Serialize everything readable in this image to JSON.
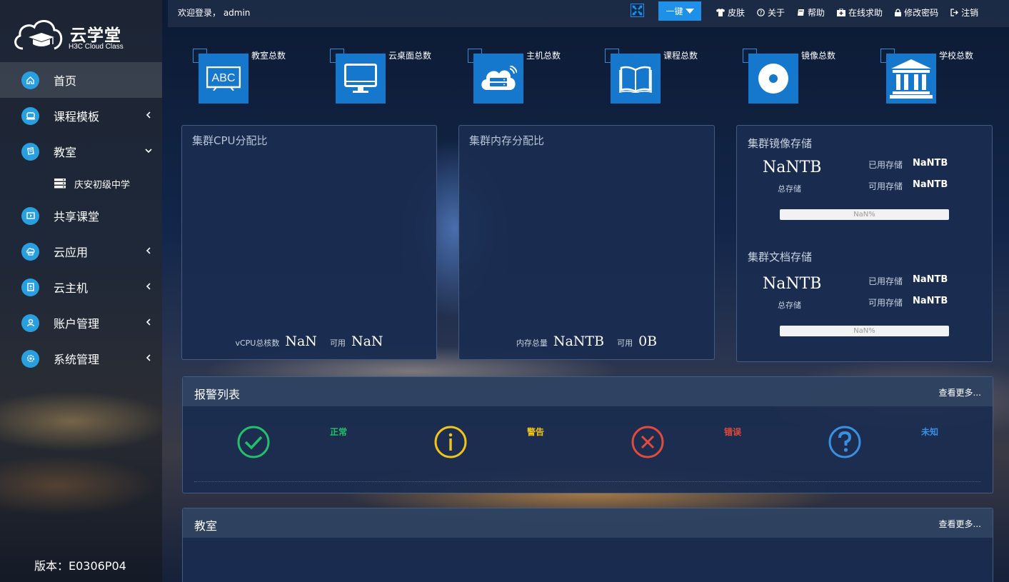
{
  "app": {
    "name": "云学堂",
    "brand": "H3C Cloud Class",
    "version_label": "版本：E0306P04"
  },
  "topbar": {
    "welcome": "欢迎登录， admin",
    "one_key": "一键",
    "links": [
      "皮肤",
      "关于",
      "帮助",
      "在线求助",
      "修改密码",
      "注销"
    ]
  },
  "sidebar": {
    "items": [
      {
        "label": "首页",
        "icon": "home-icon"
      },
      {
        "label": "课程模板",
        "icon": "template-icon"
      },
      {
        "label": "教室",
        "icon": "classroom-icon"
      },
      {
        "label": "庆安初级中学",
        "icon": "server-icon"
      },
      {
        "label": "共享课堂",
        "icon": "share-class-icon"
      },
      {
        "label": "云应用",
        "icon": "cloud-app-icon"
      },
      {
        "label": "云主机",
        "icon": "cloud-host-icon"
      },
      {
        "label": "账户管理",
        "icon": "account-icon"
      },
      {
        "label": "系统管理",
        "icon": "settings-icon"
      }
    ]
  },
  "tiles": [
    {
      "label": "教室总数",
      "icon": "abc-board-icon"
    },
    {
      "label": "云桌面总数",
      "icon": "monitor-icon"
    },
    {
      "label": "主机总数",
      "icon": "cloud-server-icon"
    },
    {
      "label": "课程总数",
      "icon": "book-icon"
    },
    {
      "label": "镜像总数",
      "icon": "disc-icon"
    },
    {
      "label": "学校总数",
      "icon": "school-icon"
    }
  ],
  "cpu": {
    "title": "集群CPU分配比",
    "total_label": "vCPU总核数",
    "total_value": "NaN",
    "avail_label": "可用",
    "avail_value": "NaN"
  },
  "memory": {
    "title": "集群内存分配比",
    "total_label": "内存总量",
    "total_value": "NaNTB",
    "avail_label": "可用",
    "avail_value": "0B"
  },
  "image_storage": {
    "title": "集群镜像存储",
    "total_value": "NaNTB",
    "total_label": "总存储",
    "used_label": "已用存储",
    "used_value": "NaNTB",
    "free_label": "可用存储",
    "free_value": "NaNTB",
    "percent": "NaN%"
  },
  "doc_storage": {
    "title": "集群文档存储",
    "total_value": "NaNTB",
    "total_label": "总存储",
    "used_label": "已用存储",
    "used_value": "NaNTB",
    "free_label": "可用存储",
    "free_value": "NaNTB",
    "percent": "NaN%"
  },
  "alarms": {
    "title": "报警列表",
    "more": "查看更多...",
    "items": [
      {
        "label": "正常",
        "color": "#22c06a",
        "icon": "check-circle-icon"
      },
      {
        "label": "警告",
        "color": "#f0c419",
        "icon": "info-circle-icon"
      },
      {
        "label": "错误",
        "color": "#e24a3b",
        "icon": "x-circle-icon"
      },
      {
        "label": "未知",
        "color": "#3a8fe0",
        "icon": "question-circle-icon"
      }
    ]
  },
  "classrooms": {
    "title": "教室",
    "more": "查看更多..."
  }
}
